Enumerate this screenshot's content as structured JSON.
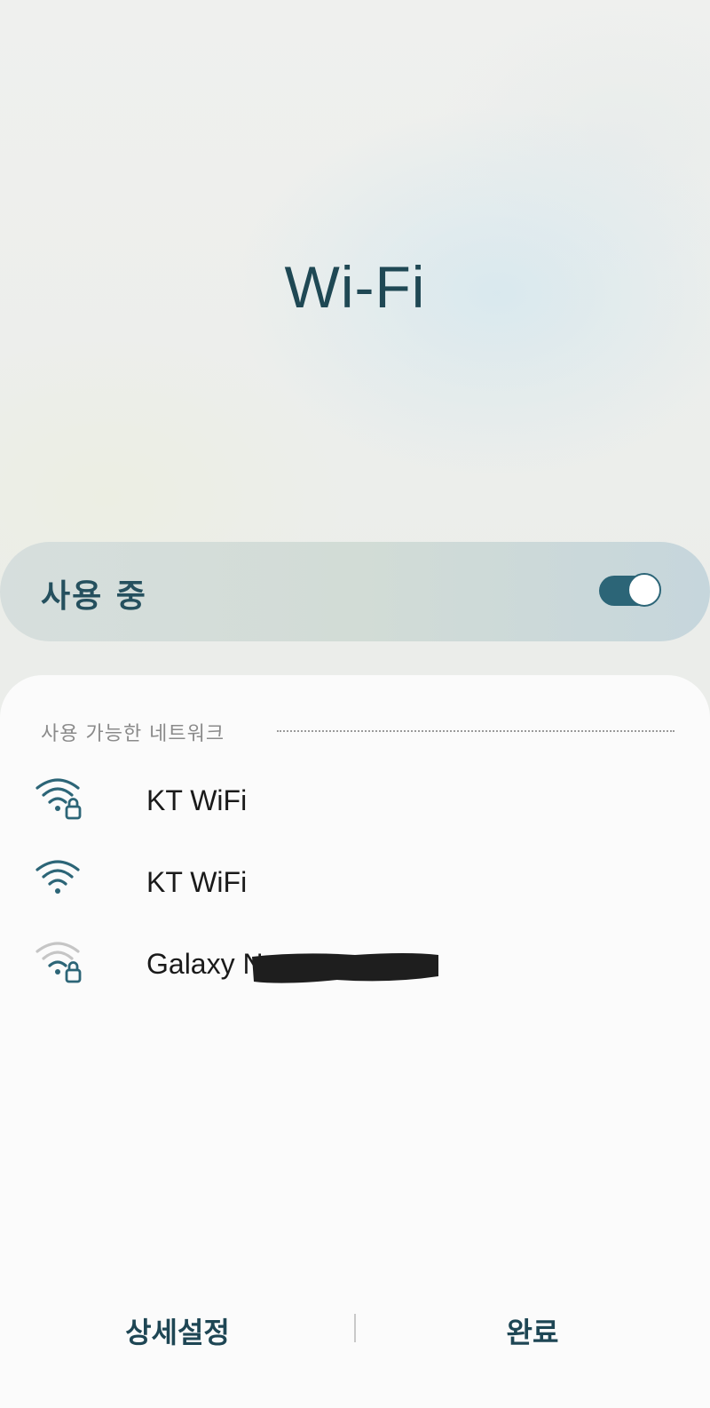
{
  "header": {
    "title": "Wi-Fi"
  },
  "master_switch": {
    "label": "사용 중",
    "enabled": true
  },
  "networks_section": {
    "label": "사용 가능한 네트워크"
  },
  "networks": [
    {
      "name": "KT WiFi",
      "secured": true,
      "signal": "full",
      "icon": "wifi-lock-icon"
    },
    {
      "name": "KT WiFi",
      "secured": false,
      "signal": "full",
      "icon": "wifi-icon"
    },
    {
      "name": "Galaxy N",
      "secured": true,
      "signal": "weak",
      "icon": "wifi-lock-icon"
    }
  ],
  "footer": {
    "advanced_label": "상세설정",
    "done_label": "완료"
  },
  "colors": {
    "accent": "#2c6577",
    "title": "#1f4854",
    "signal_strong": "#2c6577",
    "signal_weak": "#c5c5c5"
  }
}
